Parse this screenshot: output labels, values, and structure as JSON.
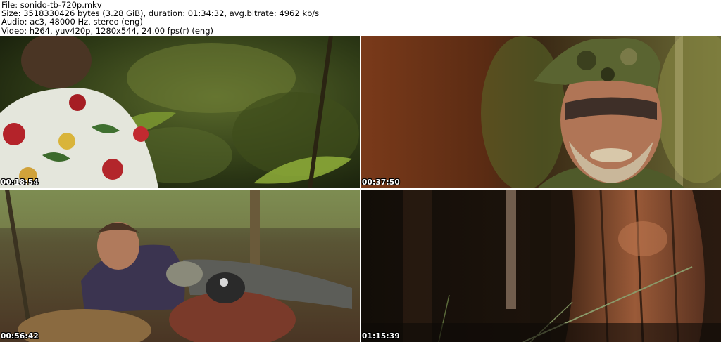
{
  "header": {
    "file_line": "File: sonido-tb-720p.mkv",
    "size_line": "Size: 3518330426 bytes (3.28 GiB), duration: 01:34:32, avg.bitrate: 4962 kb/s",
    "audio_line": "Audio: ac3, 48000 Hz, stereo (eng)",
    "video_line": "Video: h264, yuv420p, 1280x544, 24.00 fps(r) (eng)"
  },
  "thumbnails": [
    {
      "timestamp": "00:18:54"
    },
    {
      "timestamp": "00:37:50"
    },
    {
      "timestamp": "00:56:42"
    },
    {
      "timestamp": "01:15:39"
    }
  ]
}
